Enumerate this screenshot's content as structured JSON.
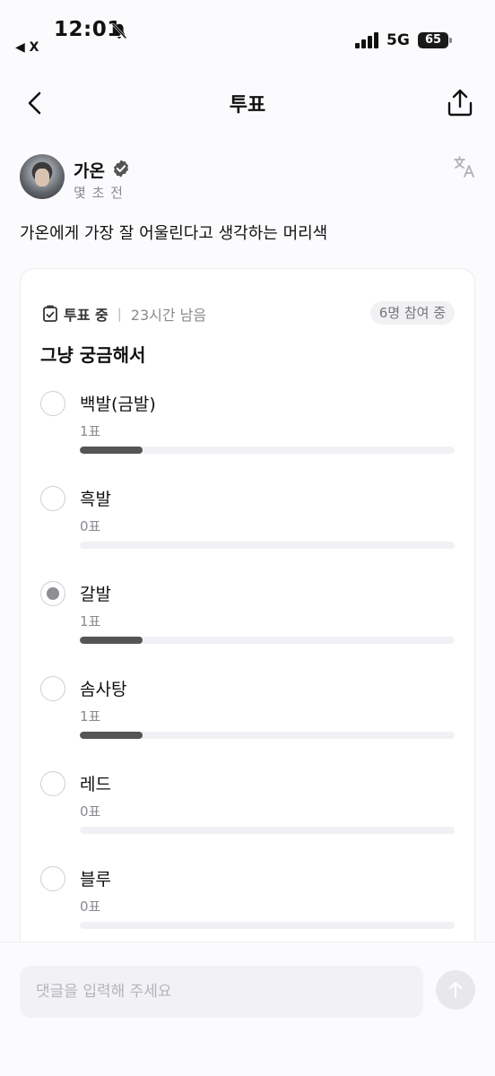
{
  "status_bar": {
    "time": "12:01",
    "back_app": "◀ X",
    "network": "5G",
    "battery": "65"
  },
  "nav": {
    "title": "투표",
    "icons": [
      "chevron-left-icon",
      "share-icon"
    ]
  },
  "post": {
    "author": "가온",
    "time": "몇 초 전",
    "text": "가온에게 가장 잘 어울린다고 생각하는 머리색"
  },
  "poll": {
    "status": "투표 중",
    "remaining": "23시간 남음",
    "participants": "6명 참여 중",
    "title": "그냥 궁금해서",
    "options": [
      {
        "label": "백발(금발)",
        "votes": "1표",
        "fraction": 0.1667,
        "selected": false
      },
      {
        "label": "흑발",
        "votes": "0표",
        "fraction": 0,
        "selected": false
      },
      {
        "label": "갈발",
        "votes": "1표",
        "fraction": 0.1667,
        "selected": true
      },
      {
        "label": "솜사탕",
        "votes": "1표",
        "fraction": 0.1667,
        "selected": false
      },
      {
        "label": "레드",
        "votes": "0표",
        "fraction": 0,
        "selected": false
      },
      {
        "label": "블루",
        "votes": "0표",
        "fraction": 0,
        "selected": false
      }
    ]
  },
  "comment": {
    "placeholder": "댓글을 입력해 주세요"
  },
  "colors": {
    "bar_fill": "#555555",
    "bar_track": "#f1f1f5",
    "verified_badge": "#555555"
  }
}
